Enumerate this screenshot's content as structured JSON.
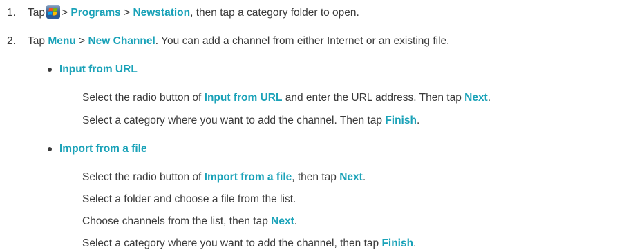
{
  "steps": [
    {
      "number": "1.",
      "pre": "Tap",
      "icon": "windows-start-icon",
      "sep1": ">",
      "link1": "Programs",
      "sep2": ">",
      "link2": "Newstation",
      "post": ", then tap a category folder to open."
    },
    {
      "number": "2.",
      "pre": "Tap",
      "link1": "Menu",
      "sep1": ">",
      "link2": "New Channel",
      "post": ". You can add a channel from either Internet or an existing file."
    }
  ],
  "bullets": [
    {
      "title": "Input from URL",
      "lines": [
        {
          "a": "Select the radio button of ",
          "b": "Input from URL",
          "c": " and enter the URL address. Then tap ",
          "d": "Next",
          "e": "."
        },
        {
          "a": "Select a category where you want to add the channel. Then tap ",
          "b": "Finish",
          "c": "."
        }
      ]
    },
    {
      "title": "Import from a file",
      "lines": [
        {
          "a": "Select the radio button of ",
          "b": "Import from a file",
          "c": ", then tap ",
          "d": "Next",
          "e": "."
        },
        {
          "a": "Select a folder and choose a file from the list."
        },
        {
          "a": "Choose channels from the list, then tap ",
          "b": "Next",
          "c": "."
        },
        {
          "a": "Select a category where you want to add the channel, then tap ",
          "b": "Finish",
          "c": "."
        }
      ]
    }
  ],
  "colors": {
    "highlight": "#1aa2b8",
    "text": "#3a3a3a"
  }
}
